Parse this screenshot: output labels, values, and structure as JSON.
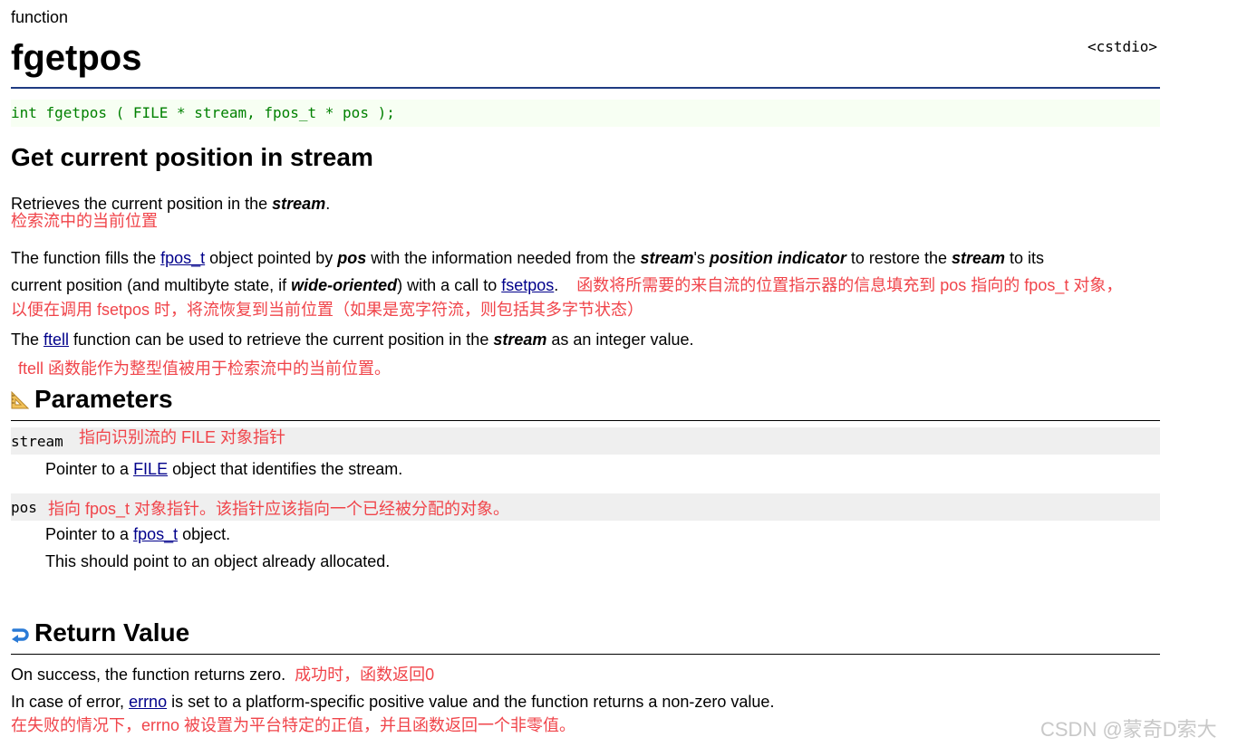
{
  "kind": "function",
  "title": "fgetpos",
  "header_file": "<cstdio>",
  "prototype": "int fgetpos ( FILE * stream, fpos_t * pos );",
  "heading": "Get current position in stream",
  "intro": {
    "pre": "Retrieves the current position in the ",
    "kw": "stream",
    "post": ".",
    "cn": "检索流中的当前位置"
  },
  "para1": {
    "t1": "The function fills the ",
    "link1": "fpos_t",
    "t2": " object pointed by ",
    "kw1": "pos",
    "t3": " with the information needed from the ",
    "kw2": "stream",
    "t4": "'s ",
    "kw3": "position indicator",
    "t5": " to restore the ",
    "kw4": "stream",
    "t6": " to its",
    "t7": "current position (and multibyte state, if ",
    "kw5": "wide-oriented",
    "t8": ") with a call to ",
    "link2": "fsetpos",
    "t9": ".",
    "cn1": "函数将所需要的来自流的位置指示器的信息填充到 pos 指向的 fpos_t 对象，",
    "cn2": "以便在调用 fsetpos 时，将流恢复到当前位置（如果是宽字符流，则包括其多字节状态）"
  },
  "para2": {
    "t1": "The ",
    "link": "ftell",
    "t2": " function can be used to retrieve the current position in the ",
    "kw": "stream",
    "t3": " as an integer value.",
    "cn": "ftell 函数能作为整型值被用于检索流中的当前位置。"
  },
  "parameters": {
    "title": "Parameters",
    "stream": {
      "name": "stream",
      "cn": "指向识别流的 FILE 对象指针",
      "d1": "Pointer to a ",
      "link": "FILE",
      "d2": " object that identifies the stream."
    },
    "pos": {
      "name": "pos",
      "cn": "指向 fpos_t 对象指针。该指针应该指向一个已经被分配的对象。",
      "d1": "Pointer to a ",
      "link": "fpos_t",
      "d2": " object.",
      "d3": "This should point to an object already allocated."
    }
  },
  "return_value": {
    "title": "Return Value",
    "s1": "On success, the function returns zero.",
    "s1_cn": "成功时，函数返回0",
    "s2a": "In case of error, ",
    "s2_link": "errno",
    "s2b": " is set to a platform-specific positive value and the function returns a non-zero value.",
    "s2_cn": "在失败的情况下，errno 被设置为平台特定的正值，并且函数返回一个非零值。"
  },
  "watermark": "CSDN @蒙奇D索大",
  "colors": {
    "accent_rule": "#1f3b82",
    "prototype_text": "#008000",
    "annotation_red": "#f0444a",
    "link": "#00008b"
  }
}
